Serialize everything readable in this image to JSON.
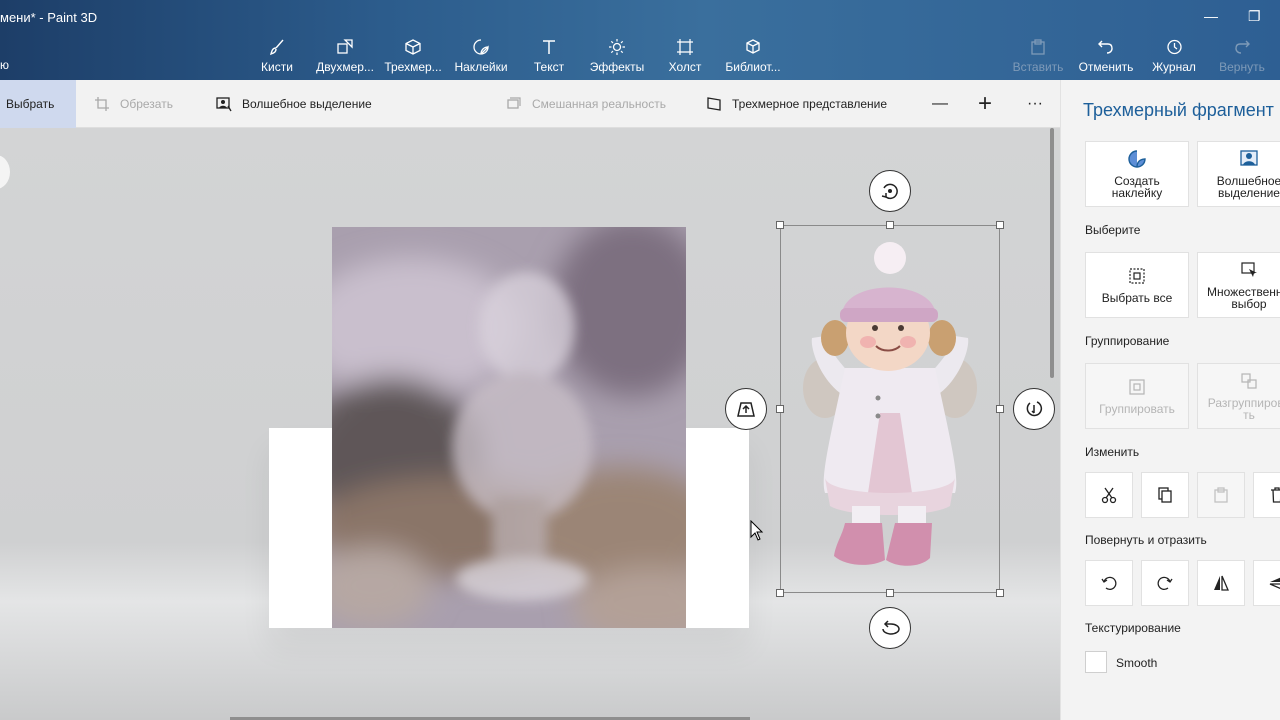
{
  "window": {
    "title": "мени* - Paint 3D",
    "menu_stub": "ю",
    "minimize_glyph": "—",
    "restore_glyph": "❐"
  },
  "ribbon": {
    "tools": [
      {
        "label": "Кисти",
        "icon": "brush-icon"
      },
      {
        "label": "Двухмер...",
        "icon": "2d-shapes-icon"
      },
      {
        "label": "Трехмер...",
        "icon": "3d-shapes-icon"
      },
      {
        "label": "Наклейки",
        "icon": "stickers-icon"
      },
      {
        "label": "Текст",
        "icon": "text-icon"
      },
      {
        "label": "Эффекты",
        "icon": "effects-icon"
      },
      {
        "label": "Холст",
        "icon": "canvas-icon"
      },
      {
        "label": "Библиот...",
        "icon": "library-icon"
      }
    ],
    "actions": [
      {
        "label": "Вставить",
        "icon": "paste-icon",
        "enabled": false
      },
      {
        "label": "Отменить",
        "icon": "undo-icon",
        "enabled": true
      },
      {
        "label": "Журнал",
        "icon": "history-icon",
        "enabled": true
      },
      {
        "label": "Вернуть",
        "icon": "redo-icon",
        "enabled": false
      }
    ]
  },
  "toolbar": {
    "select": "Выбрать",
    "crop": "Обрезать",
    "magic_select": "Волшебное выделение",
    "mixed_reality": "Смешанная реальность",
    "view_3d": "Трехмерное представление",
    "zoom_out": "—",
    "zoom_in": "+",
    "more": "···"
  },
  "panel": {
    "title": "Трехмерный фрагмент",
    "make_sticker": "Создать наклейку",
    "magic_select": "Волшебное выделение",
    "section_select": "Выберите",
    "select_all": "Выбрать все",
    "multi_select": "Множественный выбор",
    "section_group": "Группирование",
    "group": "Группировать",
    "ungroup": "Разгруппировать",
    "section_edit": "Изменить",
    "section_rotate": "Повернуть и отразить",
    "section_texture": "Текстурирование",
    "smooth": "Smooth"
  },
  "colors": {
    "accent": "#1d5f9a",
    "ribbon": "#2c5c8c",
    "select_highlight": "#cfd9ee"
  }
}
